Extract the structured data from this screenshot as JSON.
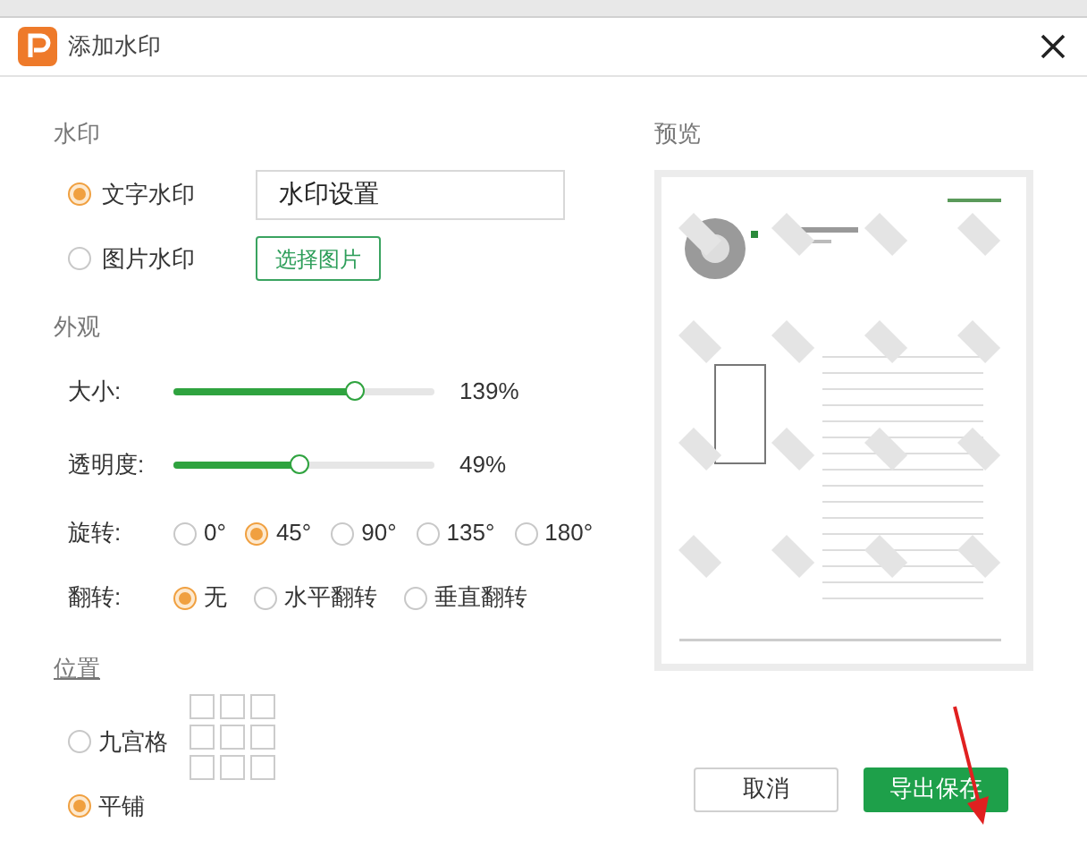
{
  "window": {
    "title": "添加水印"
  },
  "watermark": {
    "heading": "水印",
    "options": [
      {
        "label": "文字水印",
        "selected": true,
        "kind": "text",
        "value": "水印设置"
      },
      {
        "label": "图片水印",
        "selected": false,
        "kind": "image",
        "button": "选择图片"
      }
    ]
  },
  "appearance": {
    "heading": "外观",
    "sliders": [
      {
        "label": "大小:",
        "level": 0.69,
        "reading": "139%"
      },
      {
        "label": "透明度:",
        "level": 0.48,
        "reading": "49%"
      }
    ],
    "radio_rows": [
      {
        "label": "旋转:",
        "options": [
          {
            "label": "0°",
            "selected": false
          },
          {
            "label": "45°",
            "selected": true
          },
          {
            "label": "90°",
            "selected": false
          },
          {
            "label": "135°",
            "selected": false
          },
          {
            "label": "180°",
            "selected": false
          }
        ]
      },
      {
        "label": "翻转:",
        "options": [
          {
            "label": "无",
            "selected": true
          },
          {
            "label": "水平翻转",
            "selected": false
          },
          {
            "label": "垂直翻转",
            "selected": false
          }
        ]
      }
    ]
  },
  "position": {
    "heading": "位置",
    "options": [
      {
        "label": "九宫格",
        "selected": false
      },
      {
        "label": "平铺",
        "selected": true
      }
    ]
  },
  "preview": {
    "heading": "预览"
  },
  "buttons": [
    {
      "label": "取消",
      "kind": "secondary"
    },
    {
      "label": "导出保存",
      "kind": "primary"
    }
  ]
}
